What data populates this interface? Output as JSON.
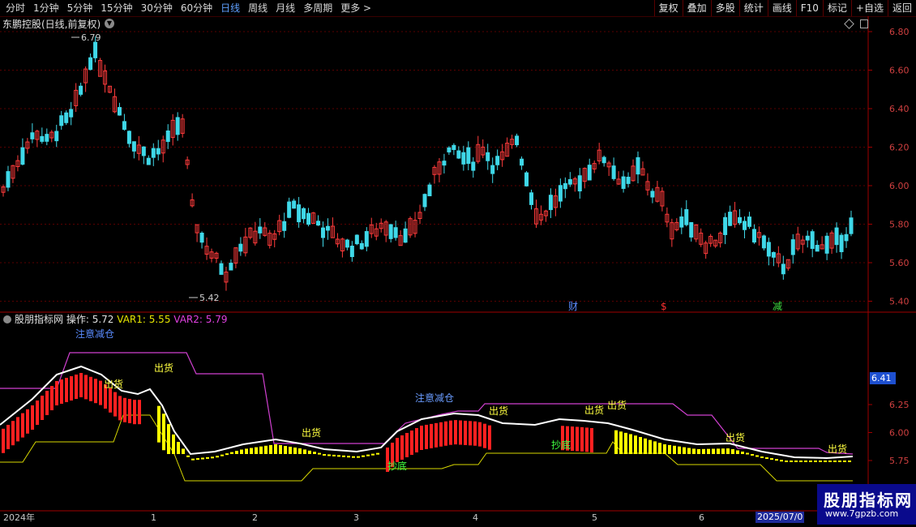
{
  "toolbar": {
    "periods": [
      "分时",
      "1分钟",
      "5分钟",
      "15分钟",
      "30分钟",
      "60分钟",
      "日线",
      "周线",
      "月线",
      "多周期",
      "更多"
    ],
    "more_icon": "chevron-right-icon",
    "buttons": [
      "复权",
      "叠加",
      "多股",
      "统计",
      "画线",
      "F10",
      "标记",
      "+自选",
      "返回"
    ]
  },
  "main_chart": {
    "title": "东鹏控股(日线,前复权)",
    "high_label": "6.79",
    "low_label": "5.42",
    "y_ticks": [
      "6.80",
      "6.60",
      "6.40",
      "6.20",
      "6.00",
      "5.80",
      "5.60",
      "5.40"
    ],
    "markers": [
      {
        "text": "财",
        "color": "#5a8cff"
      },
      {
        "text": "$",
        "color": "#ff3030"
      },
      {
        "text": "减",
        "color": "#40e040"
      }
    ]
  },
  "indicator": {
    "name": "股朋指标网",
    "op_label": "操作: 5.72",
    "var1_label": "VAR1: 5.55",
    "var2_label": "VAR2: 5.79",
    "subtitle": "注意减仓",
    "y_ticks": [
      "6.25",
      "6.00",
      "5.75",
      "5.50"
    ],
    "current_price_tag": "6.41",
    "annotations": [
      {
        "text": "出货",
        "color": "yellow"
      },
      {
        "text": "出货",
        "color": "yellow"
      },
      {
        "text": "出货",
        "color": "yellow"
      },
      {
        "text": "注意减仓",
        "color": "blue"
      },
      {
        "text": "出货",
        "color": "yellow"
      },
      {
        "text": "出货",
        "color": "yellow"
      },
      {
        "text": "出货",
        "color": "yellow"
      },
      {
        "text": "出货",
        "color": "yellow"
      },
      {
        "text": "出货",
        "color": "yellow"
      },
      {
        "text": "抄底",
        "color": "green"
      },
      {
        "text": "抄底",
        "color": "green"
      }
    ]
  },
  "date_axis": {
    "labels": [
      "2024年",
      "1",
      "2",
      "3",
      "4",
      "5",
      "6"
    ],
    "current": "2025/07/0"
  },
  "watermark": {
    "title": "股朋指标网",
    "url": "www.7gpzb.com"
  },
  "colors": {
    "up": "#ff3b3b",
    "down": "#3fd8e8",
    "grid": "#6a0000",
    "op_line": "#ffffff",
    "var1": "#d8d800",
    "var2": "#d040d0"
  }
}
